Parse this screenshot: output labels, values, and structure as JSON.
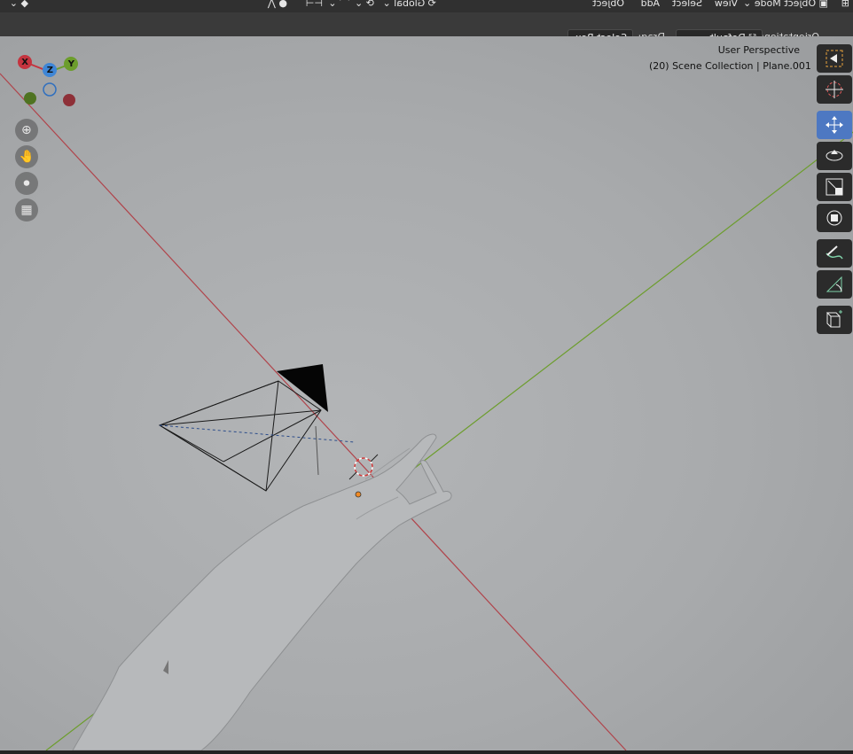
{
  "header": {
    "menu": [
      "Object",
      "Add",
      "Select",
      "View"
    ],
    "mode": "Object Mode",
    "transform_space": "Global"
  },
  "tool_header": {
    "orientation_label": "Orientation:",
    "orientation_value": "Default",
    "drag_label": "Drag:",
    "drag_value": "Select Box"
  },
  "viewport": {
    "view_name": "User Perspective",
    "collection_info": "(20) Scene Collection | Plane.001"
  },
  "gizmo": {
    "x_label": "X",
    "y_label": "Y",
    "z_label": "Z",
    "x_color": "#c4343f",
    "y_color": "#6c9d2c",
    "z_color": "#3f86d6"
  },
  "tools": [
    {
      "name": "select-box-tool",
      "icon": "select-box-icon",
      "active": false
    },
    {
      "name": "cursor-tool",
      "icon": "cursor-icon",
      "active": false
    },
    {
      "name": "move-tool",
      "icon": "move-icon",
      "active": true
    },
    {
      "name": "rotate-tool",
      "icon": "rotate-icon",
      "active": false
    },
    {
      "name": "scale-tool",
      "icon": "scale-icon",
      "active": false
    },
    {
      "name": "transform-tool",
      "icon": "transform-icon",
      "active": false
    },
    {
      "name": "annotate-tool",
      "icon": "annotate-icon",
      "active": false
    },
    {
      "name": "measure-tool",
      "icon": "measure-icon",
      "active": false
    },
    {
      "name": "add-cube-tool",
      "icon": "add-cube-icon",
      "active": false
    }
  ],
  "nav_buttons": [
    "zoom-icon",
    "hand-icon",
    "camera-icon",
    "grid-icon"
  ],
  "colors": {
    "x_axis_line": "#b0444b",
    "y_axis_line": "#6c9d2c",
    "active_tool": "#4d78c2"
  }
}
